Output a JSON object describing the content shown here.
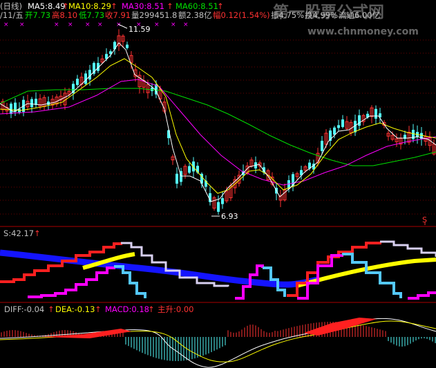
{
  "header": {
    "period": "(日线)",
    "ma5": "MA5:8.49",
    "ma10": "MA10:8.29",
    "ma30": "MA30:8.51",
    "ma60": "MA60:8.51",
    "arrow": "↑",
    "date": "/11/五",
    "open": "开7.73",
    "high": "高8.10",
    "low": "低7.73",
    "close": "收7.91",
    "volume": "量299451.8",
    "amount": "额2.38亿",
    "change": "幅0.12(1.54%)",
    "amplitude": "振4.75%",
    "turnover": "换4.99%",
    "float": "流通6.00亿"
  },
  "main": {
    "high_label": "11.59",
    "low_label": "6.93",
    "marker": "S"
  },
  "indicator1": {
    "label": "S:42.17",
    "arrow": "↑"
  },
  "indicator2": {
    "diff": "DIFF:-0.04",
    "dea": "DEA:-0.13",
    "macd": "MACD:0.18",
    "zhusheng": "主升:0.00",
    "arrow": "↑"
  },
  "watermark": {
    "title": "第一股票公式网",
    "url": "www.chnmoney.com"
  },
  "colors": {
    "up": "#ff3232",
    "down": "#54fcfc",
    "ma5": "#ffffff",
    "ma10": "#ffff00",
    "ma30": "#ff00ff",
    "ma60": "#00e000",
    "label": "#c0c0c0",
    "separator": "#aa0000",
    "grid": "#6e0000"
  },
  "chart_data": {
    "type": "candlestick",
    "price_markers": {
      "high": 11.59,
      "low": 6.93
    },
    "latest": {
      "open": 7.73,
      "high": 8.1,
      "low": 7.73,
      "close": 7.91,
      "ma5": 8.49,
      "ma10": 8.29,
      "ma30": 8.51,
      "ma60": 8.51
    },
    "indicators": {
      "S": 42.17,
      "DIFF": -0.04,
      "DEA": -0.13,
      "MACD": 0.18,
      "主升": 0.0
    }
  }
}
